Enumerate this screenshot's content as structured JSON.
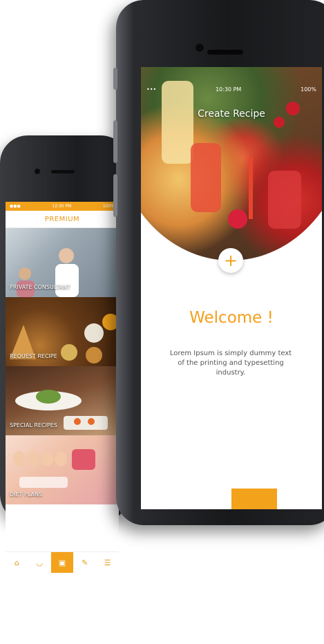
{
  "back_screen": {
    "status_time": "12:30 PM",
    "status_battery": "100%",
    "header_title": "PREMIUM",
    "tiles": [
      {
        "label": "PRIVATE CONSULTANT"
      },
      {
        "label": "REQUEST RECIPE"
      },
      {
        "label": "SPECIAL RECIPES"
      },
      {
        "label": "DIET PLANS"
      }
    ],
    "nav_icons": [
      "home-icon",
      "bowl-icon",
      "gift-icon",
      "pen-icon",
      "menu-icon"
    ]
  },
  "front_screen": {
    "status_time": "10:30 PM",
    "status_battery": "100%",
    "title": "Create Recipe",
    "plus": "+",
    "welcome": "Welcome !",
    "description": "Lorem Ipsum is simply dummy text of the printing and typesetting industry."
  },
  "colors": {
    "accent": "#f3a21c"
  }
}
